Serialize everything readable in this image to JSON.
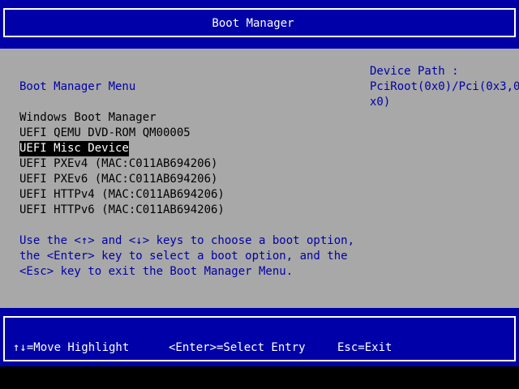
{
  "header": {
    "title": "Boot Manager"
  },
  "main": {
    "menu_title": "Boot Manager Menu",
    "boot_options": [
      {
        "label": "Windows Boot Manager",
        "selected": false
      },
      {
        "label": "UEFI QEMU DVD-ROM QM00005",
        "selected": false
      },
      {
        "label": "UEFI Misc Device",
        "selected": true
      },
      {
        "label": "UEFI PXEv4 (MAC:C011AB694206)",
        "selected": false
      },
      {
        "label": "UEFI PXEv6 (MAC:C011AB694206)",
        "selected": false
      },
      {
        "label": "UEFI HTTPv4 (MAC:C011AB694206)",
        "selected": false
      },
      {
        "label": "UEFI HTTPv6 (MAC:C011AB694206)",
        "selected": false
      }
    ],
    "help_lines": [
      "Use the <↑> and <↓> keys to choose a boot option,",
      "the <Enter> key to select a boot option, and the",
      "<Esc> key to exit the Boot Manager Menu."
    ],
    "device_path": {
      "label": "Device Path :",
      "value_lines": [
        "PciRoot(0x0)/Pci(0x3,0",
        "x0)"
      ]
    }
  },
  "footer": {
    "move_hint": "↑↓=Move Highlight",
    "select_hint": "<Enter>=Select Entry",
    "exit_hint": "Esc=Exit"
  },
  "colors": {
    "background_blue": "#0000a8",
    "panel_grey": "#a8a8a8",
    "text_blue": "#0000a8",
    "text_black": "#000000",
    "highlight_bg": "#000000",
    "highlight_fg": "#ffffff"
  }
}
